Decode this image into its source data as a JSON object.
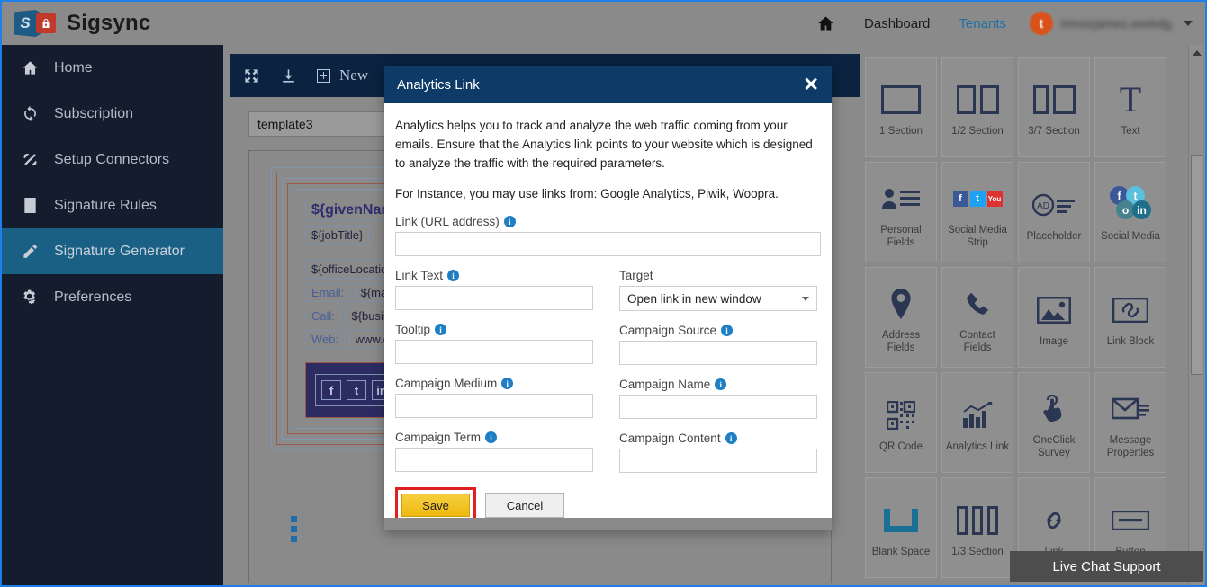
{
  "brand": {
    "name": "Sigsync",
    "logo_letter": "S",
    "lock_icon": "lock-icon"
  },
  "topnav": {
    "home_icon": "home-icon",
    "dashboard": "Dashboard",
    "tenants": "Tenants",
    "user": {
      "initial": "t",
      "name": "trevorjames.workdg.",
      "caret": "chevron-down-icon"
    }
  },
  "sidebar": {
    "items": [
      {
        "label": "Home",
        "icon": "home-icon",
        "active": false
      },
      {
        "label": "Subscription",
        "icon": "refresh-icon",
        "active": false
      },
      {
        "label": "Setup Connectors",
        "icon": "plug-icon",
        "active": false
      },
      {
        "label": "Signature Rules",
        "icon": "document-icon",
        "active": false
      },
      {
        "label": "Signature Generator",
        "icon": "pencil-icon",
        "active": true
      },
      {
        "label": "Preferences",
        "icon": "gears-icon",
        "active": false
      }
    ]
  },
  "editor": {
    "toolbar": {
      "expand_icon": "expand-icon",
      "download_icon": "download-icon",
      "new_label": "New"
    },
    "template_name": "template3",
    "signature": {
      "given_name": "${givenName}",
      "job_title": "${jobTitle}",
      "office_location": "${officeLocation}",
      "email_label": "Email:",
      "email_value": "${mail}",
      "call_label": "Call:",
      "call_value": "${businessP",
      "web_label": "Web:",
      "web_value": "www.exam",
      "social_icon": "facebook-icon"
    }
  },
  "widgets": {
    "items": [
      {
        "label": "1 Section",
        "icon": "one-section-icon"
      },
      {
        "label": "1/2 Section",
        "icon": "half-section-icon"
      },
      {
        "label": "3/7 Section",
        "icon": "three-seven-section-icon"
      },
      {
        "label": "Text",
        "icon": "text-icon"
      },
      {
        "label": "Personal Fields",
        "icon": "personal-fields-icon"
      },
      {
        "label": "Social Media Strip",
        "icon": "social-media-strip-icon"
      },
      {
        "label": "Placeholder",
        "icon": "placeholder-icon"
      },
      {
        "label": "Social Media",
        "icon": "social-media-icon"
      },
      {
        "label": "Address Fields",
        "icon": "map-pin-icon"
      },
      {
        "label": "Contact Fields",
        "icon": "phone-icon"
      },
      {
        "label": "Image",
        "icon": "image-icon"
      },
      {
        "label": "Link Block",
        "icon": "link-block-icon"
      },
      {
        "label": "QR Code",
        "icon": "qr-code-icon"
      },
      {
        "label": "Analytics Link",
        "icon": "analytics-icon"
      },
      {
        "label": "OneClick Survey",
        "icon": "click-hand-icon"
      },
      {
        "label": "Message Properties",
        "icon": "envelope-icon"
      },
      {
        "label": "Blank Space",
        "icon": "blank-space-icon"
      },
      {
        "label": "1/3 Section",
        "icon": "third-section-icon"
      },
      {
        "label": "Link",
        "icon": "link-icon"
      },
      {
        "label": "Button",
        "icon": "button-icon"
      }
    ]
  },
  "modal": {
    "title": "Analytics Link",
    "close_icon": "close-icon",
    "paragraph1": "Analytics helps you to track and analyze the web traffic coming from your emails. Ensure that the Analytics link points to your website which is designed to analyze the traffic with the required parameters.",
    "paragraph2": "For Instance, you may use links from: Google Analytics, Piwik, Woopra.",
    "fields": {
      "link_url": {
        "label": "Link (URL address)",
        "value": "",
        "info_icon": "info-icon"
      },
      "link_text": {
        "label": "Link Text",
        "value": "",
        "info_icon": "info-icon"
      },
      "target": {
        "label": "Target",
        "value": "Open link in new window",
        "caret": "chevron-down-icon"
      },
      "tooltip": {
        "label": "Tooltip",
        "value": "",
        "info_icon": "info-icon"
      },
      "campaign_source": {
        "label": "Campaign Source",
        "value": "",
        "info_icon": "info-icon"
      },
      "campaign_medium": {
        "label": "Campaign Medium",
        "value": "",
        "info_icon": "info-icon"
      },
      "campaign_name": {
        "label": "Campaign Name",
        "value": "",
        "info_icon": "info-icon"
      },
      "campaign_term": {
        "label": "Campaign Term",
        "value": "",
        "info_icon": "info-icon"
      },
      "campaign_content": {
        "label": "Campaign Content",
        "value": "",
        "info_icon": "info-icon"
      }
    },
    "save_label": "Save",
    "cancel_label": "Cancel"
  },
  "livechat": {
    "label": "Live Chat Support"
  },
  "colors": {
    "sidebar_bg": "#141c2e",
    "sidebar_active": "#1a6085",
    "modal_header": "#0d3a66",
    "save_button": "#eeb910",
    "highlight_border": "#e02020",
    "accent_link": "#1d6fa5",
    "avatar": "#d9521a"
  }
}
